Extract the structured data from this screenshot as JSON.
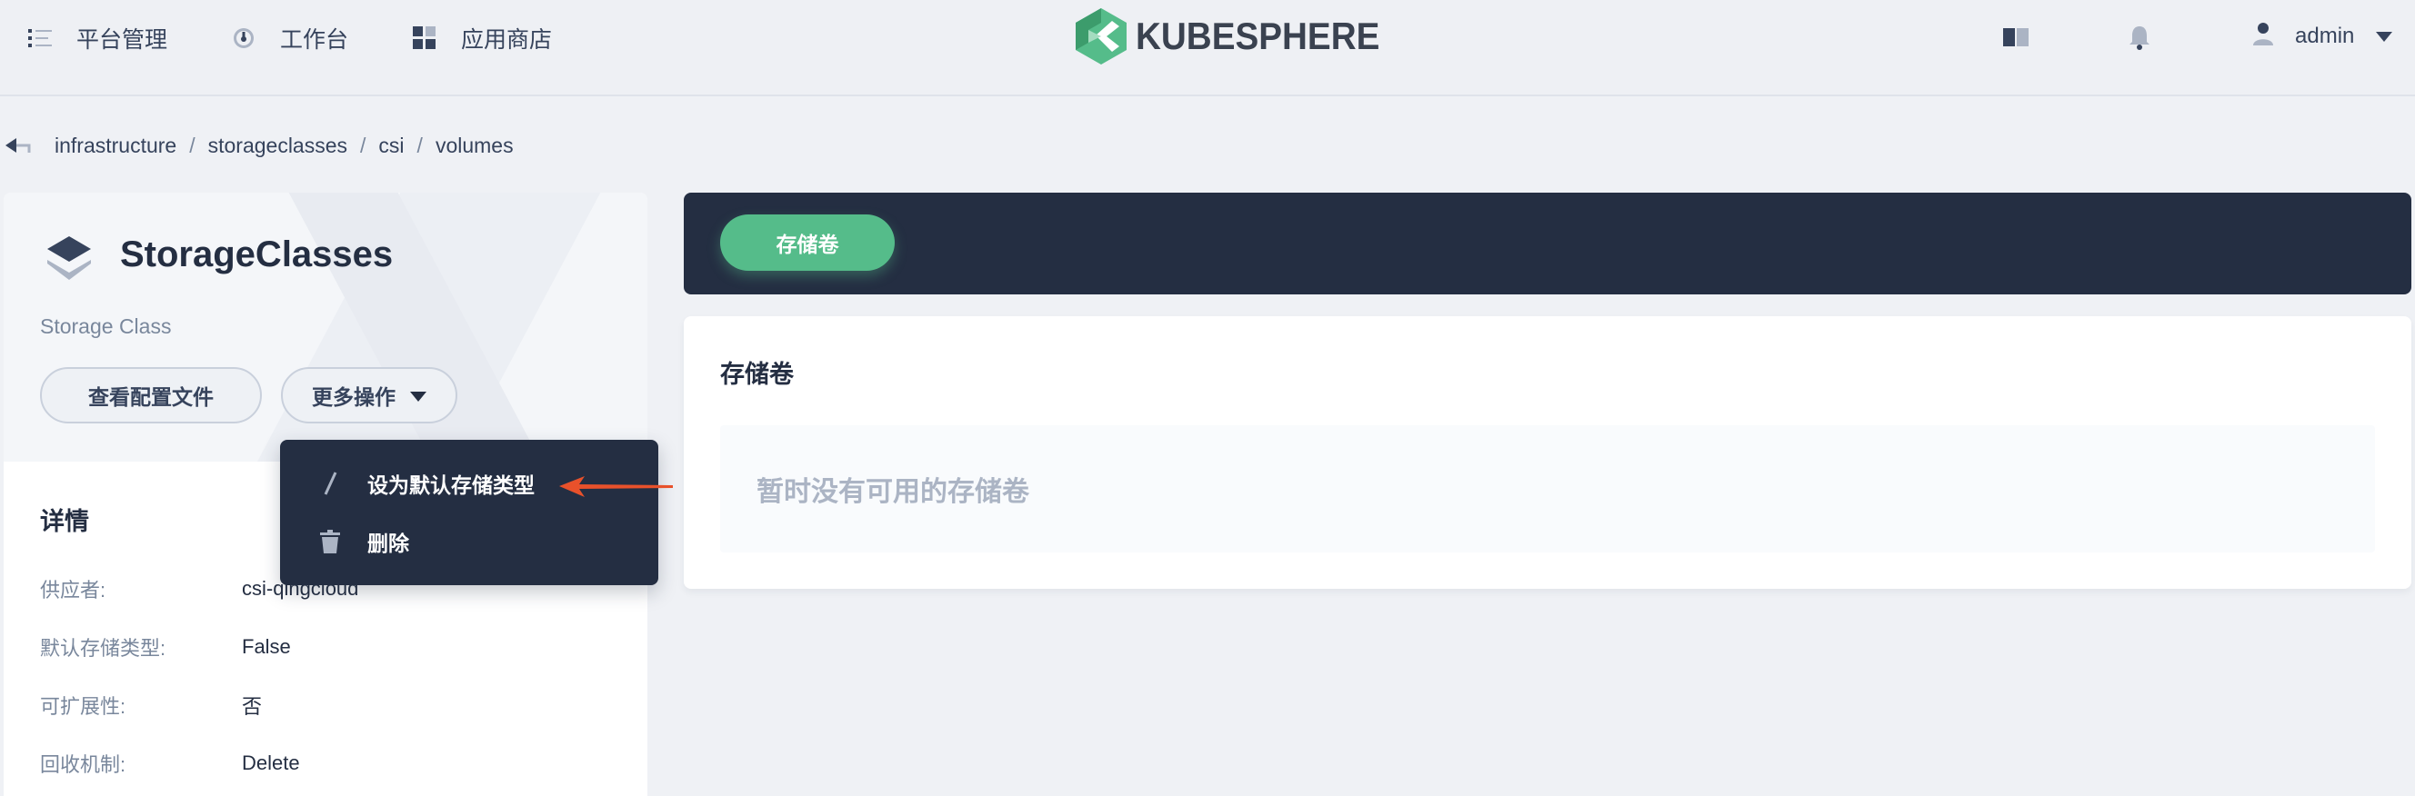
{
  "header": {
    "nav": [
      {
        "label": "平台管理",
        "icon": "list-icon"
      },
      {
        "label": "工作台",
        "icon": "dashboard-icon"
      },
      {
        "label": "应用商店",
        "icon": "appstore-icon"
      }
    ],
    "logo_text": "KUBESPHERE",
    "user_name": "admin"
  },
  "breadcrumb": [
    "infrastructure",
    "storageclasses",
    "csi",
    "volumes"
  ],
  "resource": {
    "title": "StorageClasses",
    "subtitle": "Storage Class",
    "view_config_label": "查看配置文件",
    "more_actions_label": "更多操作"
  },
  "details": {
    "title": "详情",
    "rows": [
      {
        "key": "供应者:",
        "value": "csi-qingcloud"
      },
      {
        "key": "默认存储类型:",
        "value": "False"
      },
      {
        "key": "可扩展性:",
        "value": "否"
      },
      {
        "key": "回收机制:",
        "value": "Delete"
      }
    ]
  },
  "dropdown": {
    "items": [
      {
        "label": "设为默认存储类型",
        "icon": "pen-icon"
      },
      {
        "label": "删除",
        "icon": "trash-icon"
      }
    ]
  },
  "tabs": [
    {
      "label": "存储卷"
    }
  ],
  "volumes": {
    "title": "存储卷",
    "empty_text": "暂时没有可用的存储卷"
  },
  "colors": {
    "primary_green": "#55bc8a",
    "dark": "#242e42",
    "annotation_arrow": "#e8512b"
  }
}
